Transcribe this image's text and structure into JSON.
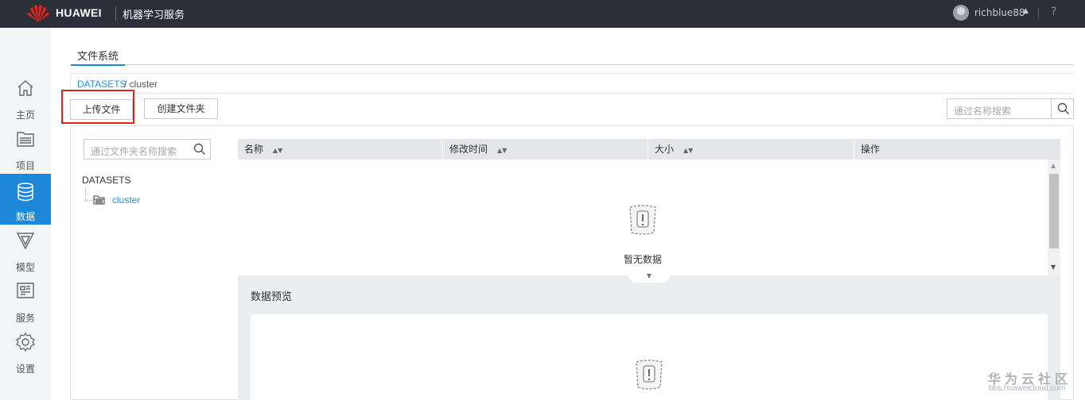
{
  "header": {
    "brand": "HUAWEI",
    "app_title": "机器学习服务",
    "username": "richblue88",
    "user_caret": "▲",
    "help": "?"
  },
  "sidebar": {
    "items": [
      {
        "label": "主页",
        "icon": "home-icon"
      },
      {
        "label": "项目",
        "icon": "project-icon"
      },
      {
        "label": "数据",
        "icon": "database-icon",
        "active": true
      },
      {
        "label": "模型",
        "icon": "model-icon"
      },
      {
        "label": "服务",
        "icon": "service-icon"
      },
      {
        "label": "设置",
        "icon": "gear-icon"
      }
    ]
  },
  "tabs": [
    {
      "label": "文件系统",
      "active": true
    }
  ],
  "breadcrumb": {
    "link": "DATASETS",
    "rest": "/ cluster"
  },
  "toolbar": {
    "upload_label": "上传文件",
    "mkdir_label": "创建文件夹",
    "search_placeholder": "通过名称搜索"
  },
  "folder_tree": {
    "search_placeholder": "通过文件夹名称搜索",
    "root": "DATASETS",
    "children": [
      "cluster"
    ]
  },
  "table": {
    "columns": [
      "名称",
      "修改时间",
      "大小",
      "操作"
    ],
    "empty_text": "暂无数据"
  },
  "preview": {
    "title": "数据预览"
  },
  "watermark": {
    "main": "华为云社区",
    "sub": "bbs.huaweicloud.com"
  },
  "colors": {
    "topbar": "#2b2f3a",
    "accent": "#1e88d8",
    "highlight": "#d9261c",
    "link": "#2b8fd6"
  }
}
